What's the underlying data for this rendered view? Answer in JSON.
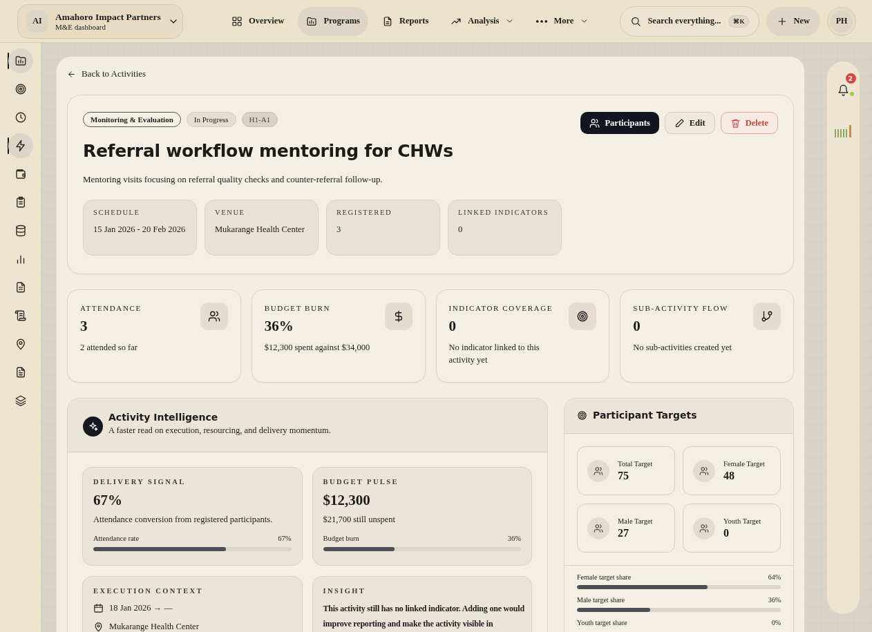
{
  "org": {
    "initials": "AI",
    "name": "Amahoro Impact Partners",
    "subtitle": "M&E dashboard"
  },
  "nav": [
    {
      "label": "Overview",
      "kind": "grid",
      "selected": false,
      "dropdown": false
    },
    {
      "label": "Programs",
      "kind": "folder",
      "selected": true,
      "dropdown": false
    },
    {
      "label": "Reports",
      "kind": "doc",
      "selected": false,
      "dropdown": false
    },
    {
      "label": "Analysis",
      "kind": "trend",
      "selected": false,
      "dropdown": true
    },
    {
      "label": "More",
      "kind": "dots",
      "selected": false,
      "dropdown": true
    }
  ],
  "search": {
    "placeholder": "Search everything...",
    "shortcut": "⌘K"
  },
  "new_button": "New",
  "user": {
    "initials": "PH"
  },
  "sidebar": {
    "items": [
      {
        "kind": "folder",
        "selected": true
      },
      {
        "kind": "target",
        "selected": false
      },
      {
        "kind": "clock",
        "selected": false
      },
      {
        "kind": "bolt",
        "selected": true
      },
      {
        "kind": "wallet",
        "selected": false
      },
      {
        "kind": "clipboard",
        "selected": false
      },
      {
        "kind": "database",
        "selected": false
      },
      {
        "kind": "bars",
        "selected": false
      },
      {
        "kind": "sheet",
        "selected": false
      },
      {
        "kind": "scroll",
        "selected": false
      },
      {
        "kind": "pin",
        "selected": false
      },
      {
        "kind": "file",
        "selected": false
      },
      {
        "kind": "layers",
        "selected": false
      }
    ]
  },
  "notifications": {
    "count": "2"
  },
  "back_link": "Back to Activities",
  "activity": {
    "tags": [
      {
        "label": "Monitoring & Evaluation",
        "kind": "outline"
      },
      {
        "label": "In Progress",
        "kind": "soft"
      },
      {
        "label": "H1-A1",
        "kind": "code"
      }
    ],
    "title": "Referral workflow mentoring for CHWs",
    "description": "Mentoring visits focusing on referral quality checks and counter-referral follow-up.",
    "actions": [
      {
        "label": "Participants",
        "kind": "primary"
      },
      {
        "label": "Edit",
        "kind": "secondary"
      },
      {
        "label": "Delete",
        "kind": "danger"
      }
    ],
    "facts": [
      {
        "label": "SCHEDULE",
        "value": "15 Jan 2026 - 20 Feb 2026"
      },
      {
        "label": "VENUE",
        "value": "Mukarange Health Center"
      },
      {
        "label": "REGISTERED",
        "value": "3"
      },
      {
        "label": "LINKED INDICATORS",
        "value": "0"
      }
    ]
  },
  "stats": [
    {
      "label": "ATTENDANCE",
      "value": "3",
      "note": "2 attended so far",
      "kind": "people"
    },
    {
      "label": "BUDGET BURN",
      "value": "36%",
      "note": "$12,300 spent against $34,000",
      "kind": "money"
    },
    {
      "label": "INDICATOR COVERAGE",
      "value": "0",
      "note": "No indicator linked to this activity yet",
      "kind": "target"
    },
    {
      "label": "SUB-ACTIVITY FLOW",
      "value": "0",
      "note": "No sub-activities created yet",
      "kind": "branch"
    }
  ],
  "intelligence": {
    "title": "Activity Intelligence",
    "subtitle": "A faster read on execution, resourcing, and delivery momentum.",
    "cards": [
      {
        "kind": "meter",
        "label": "DELIVERY SIGNAL",
        "value": "67%",
        "note": "Attendance conversion from registered participants.",
        "meter_label": "Attendance rate",
        "reading": "67%",
        "level": 0.67
      },
      {
        "kind": "meter",
        "label": "BUDGET PULSE",
        "value": "$12,300",
        "note": "$21,700 still unspent",
        "meter_label": "Budget burn",
        "reading": "36%",
        "level": 0.36
      },
      {
        "kind": "context",
        "label": "EXECUTION CONTEXT",
        "lines": [
          {
            "kind": "date",
            "text": "18 Jan 2026 → —"
          },
          {
            "kind": "place",
            "text": "Mukarange Health Center"
          }
        ]
      },
      {
        "kind": "text",
        "label": "INSIGHT",
        "text": "This activity still has no linked indicator. Adding one would improve reporting and make the activity visible in"
      }
    ]
  },
  "targets": {
    "title": "Participant Targets",
    "items": [
      {
        "label": "Total Target",
        "value": "75"
      },
      {
        "label": "Female Target",
        "value": "48"
      },
      {
        "label": "Male Target",
        "value": "27"
      },
      {
        "label": "Youth Target",
        "value": "0"
      }
    ],
    "shares": [
      {
        "label": "Female target share",
        "reading": "64%",
        "level": 0.64
      },
      {
        "label": "Male target share",
        "reading": "36%",
        "level": 0.36
      },
      {
        "label": "Youth target share",
        "reading": "0%"
      }
    ]
  }
}
